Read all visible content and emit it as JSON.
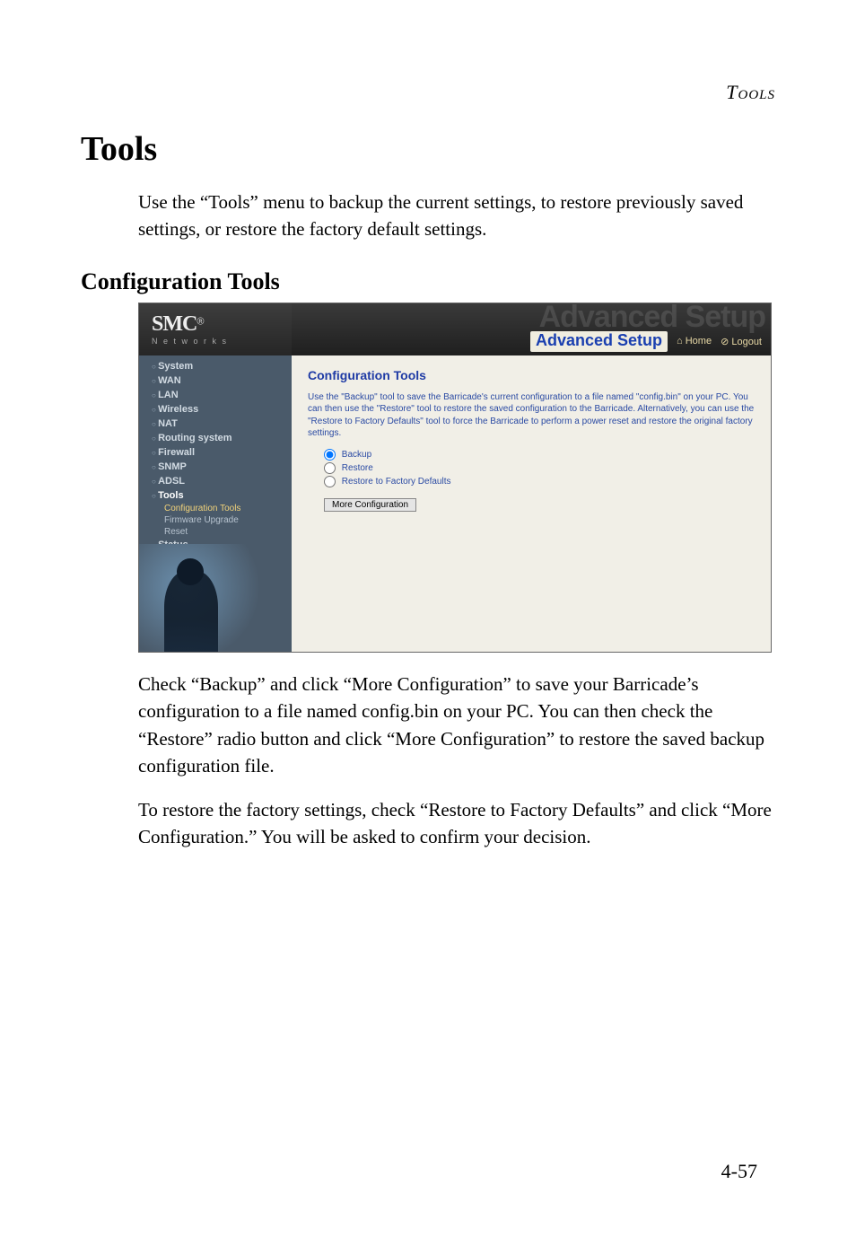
{
  "header_label": "Tools",
  "h1": "Tools",
  "intro": "Use the “Tools” menu to backup the current settings, to restore previously saved settings, or restore the factory default settings.",
  "h2": "Configuration Tools",
  "screenshot": {
    "logo": "SMC",
    "logo_reg": "®",
    "logo_sub": "N e t w o r k s",
    "banner_faded": "Advanced Setup",
    "setup_label": "Advanced Setup",
    "home_link": "Home",
    "logout_link": "Logout",
    "nav": {
      "items": [
        "System",
        "WAN",
        "LAN",
        "Wireless",
        "NAT",
        "Routing system",
        "Firewall",
        "SNMP",
        "ADSL",
        "Tools"
      ],
      "tools_sub": [
        "Configuration Tools",
        "Firmware Upgrade",
        "Reset"
      ],
      "status": "Status"
    },
    "panel": {
      "title": "Configuration Tools",
      "desc": "Use the \"Backup\" tool to save the Barricade's current configuration to a file named \"config.bin\" on your PC. You can then use the \"Restore\" tool to restore the saved configuration to the Barricade. Alternatively, you can use the \"Restore to Factory Defaults\" tool to force the Barricade to perform a power reset and restore the original factory settings.",
      "opt_backup": "Backup",
      "opt_restore": "Restore",
      "opt_factory": "Restore to Factory Defaults",
      "button": "More Configuration"
    }
  },
  "chart_data": {
    "type": "table",
    "description": "Radio-button option group in the Configuration Tools panel",
    "options": [
      {
        "label": "Backup",
        "selected": true
      },
      {
        "label": "Restore",
        "selected": false
      },
      {
        "label": "Restore to Factory Defaults",
        "selected": false
      }
    ]
  },
  "para1": "Check “Backup” and click “More Configuration” to save your Barricade’s configuration to a file named config.bin on your PC. You can then check the “Restore” radio button and click “More Configuration” to restore the saved backup configuration file.",
  "para2": "To restore the factory settings, check “Restore to Factory Defaults” and click “More Configuration.” You will be asked to confirm your decision.",
  "page_number": "4-57"
}
